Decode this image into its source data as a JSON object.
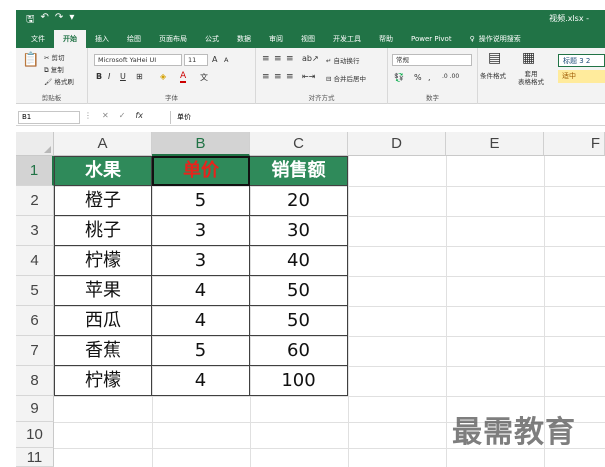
{
  "window": {
    "file_name": "视频.xlsx -"
  },
  "quick_access": {
    "save_icon": "save-icon",
    "undo_icon": "undo-icon",
    "redo_icon": "redo-icon"
  },
  "tabs": [
    "文件",
    "开始",
    "插入",
    "绘图",
    "页面布局",
    "公式",
    "数据",
    "审阅",
    "视图",
    "开发工具",
    "帮助",
    "Power Pivot",
    "操作说明搜索"
  ],
  "active_tab": "开始",
  "ribbon": {
    "clipboard": {
      "cut": "剪切",
      "copy": "复制",
      "format_painter": "格式刷",
      "label": "剪贴板"
    },
    "font": {
      "name": "Microsoft YaHei UI",
      "size": "11",
      "grow": "A",
      "shrink": "A",
      "bold": "B",
      "italic": "I",
      "underline": "U",
      "label": "字体"
    },
    "alignment": {
      "wrap_text": "自动换行",
      "merge_center": "合并后居中",
      "label": "对齐方式"
    },
    "number": {
      "format": "常规",
      "percent": "%",
      "label": "数字"
    },
    "styles": {
      "conditional": "条件格式",
      "table_format": "套用\n表格格式",
      "style1": "标题 3 2",
      "style2": "适中"
    }
  },
  "formula_bar": {
    "name_box": "B1",
    "fx": "fx",
    "content": "单价"
  },
  "columns": [
    "A",
    "B",
    "C",
    "D",
    "E",
    "F"
  ],
  "selected_column": "B",
  "rows": [
    "1",
    "2",
    "3",
    "4",
    "5",
    "6",
    "7",
    "8",
    "9",
    "10",
    "11"
  ],
  "selected_row": "1",
  "table": {
    "headers": [
      "水果",
      "单价",
      "销售额"
    ],
    "data": [
      [
        "橙子",
        "5",
        "20"
      ],
      [
        "桃子",
        "3",
        "30"
      ],
      [
        "柠檬",
        "3",
        "40"
      ],
      [
        "苹果",
        "4",
        "50"
      ],
      [
        "西瓜",
        "4",
        "50"
      ],
      [
        "香蕉",
        "5",
        "60"
      ],
      [
        "柠檬",
        "4",
        "100"
      ]
    ]
  },
  "colors": {
    "header_fill": "#2f8a5a",
    "active_header_text": "#e8231c",
    "excel_green": "#217346"
  },
  "watermark": "最需教育"
}
